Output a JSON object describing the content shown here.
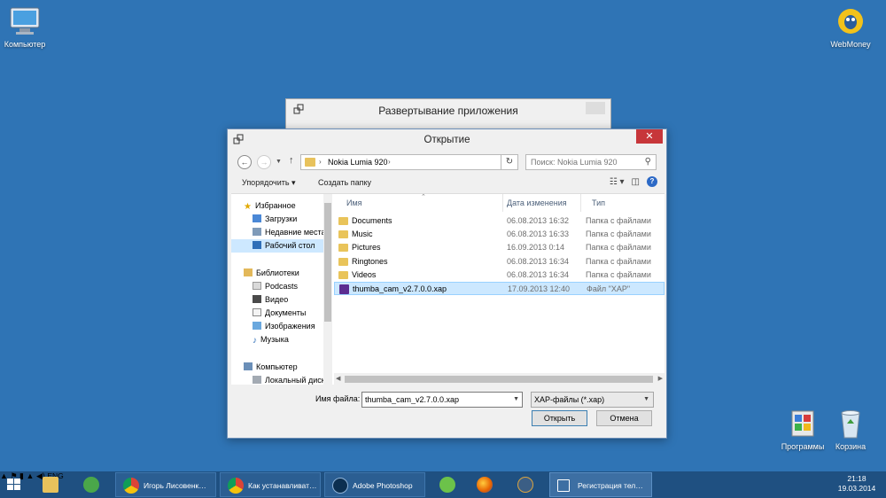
{
  "desktop": {
    "icons": [
      {
        "label": "Компьютер"
      },
      {
        "label": "WebMoney"
      },
      {
        "label": "Программы"
      },
      {
        "label": "Корзина"
      }
    ]
  },
  "background_window": {
    "title": "Развертывание приложения"
  },
  "dialog": {
    "title": "Открытие",
    "close_glyph": "✕",
    "address": {
      "path": "Nokia Lumia 920"
    },
    "search": {
      "placeholder": "Поиск: Nokia Lumia 920"
    },
    "toolbar": {
      "organize_label": "Упорядочить ▾",
      "new_folder_label": "Создать папку"
    },
    "nav_pane": {
      "items": [
        {
          "label": "Избранное",
          "icon": "star-icon"
        },
        {
          "label": "Загрузки",
          "icon": "downloads-icon"
        },
        {
          "label": "Недавние места",
          "icon": "recent-places-icon"
        },
        {
          "label": "Рабочий стол",
          "icon": "desktop-icon",
          "selected": true
        },
        {
          "label": "Библиотеки",
          "icon": "libraries-icon"
        },
        {
          "label": "Podcasts",
          "icon": "podcasts-icon"
        },
        {
          "label": "Видео",
          "icon": "video-icon"
        },
        {
          "label": "Документы",
          "icon": "documents-icon"
        },
        {
          "label": "Изображения",
          "icon": "pictures-icon"
        },
        {
          "label": "Музыка",
          "icon": "music-icon"
        },
        {
          "label": "Компьютер",
          "icon": "computer-icon"
        },
        {
          "label": "Локальный диск",
          "icon": "local-disk-icon"
        }
      ]
    },
    "columns": {
      "name": "Имя",
      "date": "Дата изменения",
      "type": "Тип"
    },
    "files": [
      {
        "name": "Documents",
        "date": "06.08.2013 16:32",
        "type": "Папка с файлами",
        "kind": "folder"
      },
      {
        "name": "Music",
        "date": "06.08.2013 16:33",
        "type": "Папка с файлами",
        "kind": "folder"
      },
      {
        "name": "Pictures",
        "date": "16.09.2013 0:14",
        "type": "Папка с файлами",
        "kind": "folder"
      },
      {
        "name": "Ringtones",
        "date": "06.08.2013 16:34",
        "type": "Папка с файлами",
        "kind": "folder"
      },
      {
        "name": "Videos",
        "date": "06.08.2013 16:34",
        "type": "Папка с файлами",
        "kind": "folder"
      },
      {
        "name": "thumba_cam_v2.7.0.0.xap",
        "date": "17.09.2013 12:40",
        "type": "Файл \"XAP\"",
        "kind": "xap",
        "selected": true
      }
    ],
    "filename_label": "Имя файла:",
    "filename_value": "thumba_cam_v2.7.0.0.xap",
    "filetype_value": "XAP-файлы (*.xap)",
    "open_label": "Открыть",
    "cancel_label": "Отмена"
  },
  "taskbar": {
    "items": [
      {
        "label": "",
        "icon": "file-explorer-icon"
      },
      {
        "label": "",
        "icon": "utorrent-icon"
      },
      {
        "label": "Игорь Лисовенк…",
        "icon": "chrome-icon"
      },
      {
        "label": "Как устанавливат…",
        "icon": "chrome-icon"
      },
      {
        "label": "Adobe Photoshop",
        "icon": "photoshop-icon"
      },
      {
        "label": "",
        "icon": "icq-icon"
      },
      {
        "label": "",
        "icon": "firefox-icon"
      },
      {
        "label": "",
        "icon": "owl-icon"
      },
      {
        "label": "Регистрация тел…",
        "icon": "app-deploy-icon"
      }
    ],
    "language": "ENG",
    "time": "21:18",
    "date": "19.03.2014"
  }
}
